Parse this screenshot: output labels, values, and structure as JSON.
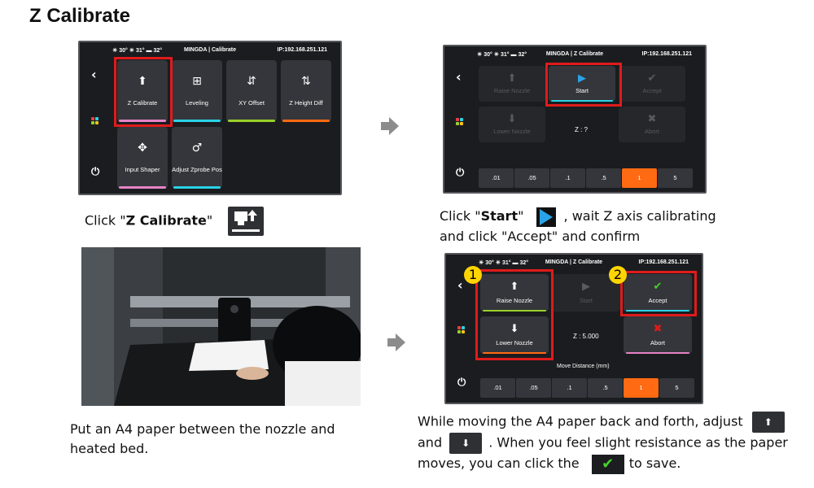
{
  "heading": "Z Calibrate",
  "status": {
    "temps": "☀ 30° ☀ 31° ▬ 32°",
    "ip": "IP:192.168.251.121"
  },
  "screen1": {
    "title": "MINGDA | Calibrate",
    "tiles": [
      {
        "label": "Z Calibrate",
        "glyph": "⬆",
        "bar": "#e683c7"
      },
      {
        "label": "Leveling",
        "glyph": "⊞",
        "bar": "#2ad2e6"
      },
      {
        "label": "XY Offset",
        "glyph": "↕",
        "bar": "#9ad12a"
      },
      {
        "label": "Z Height Diff",
        "glyph": "↕",
        "bar": "#ff6a13"
      },
      {
        "label": "Input Shaper",
        "glyph": "✥",
        "bar": "#e683c7"
      },
      {
        "label": "Adjust Zprobe Pos",
        "glyph": "♂",
        "bar": "#2ad2e6"
      }
    ]
  },
  "screen2": {
    "title": "MINGDA | Z Calibrate",
    "raise": "Raise Nozzle",
    "start": "Start",
    "accept": "Accept",
    "lower": "Lower Nozzle",
    "abort": "Abort",
    "z_value": "Z : ?",
    "distances": [
      ".01",
      ".05",
      ".1",
      ".5",
      "1",
      "5"
    ]
  },
  "screen3": {
    "title": "MINGDA | Z Calibrate",
    "raise": "Raise Nozzle",
    "start": "Start",
    "accept": "Accept",
    "lower": "Lower Nozzle",
    "abort": "Abort",
    "z_value": "Z : 5.000",
    "move_distance": "Move Distance (mm)",
    "distances": [
      ".01",
      ".05",
      ".1",
      ".5",
      "1",
      "5"
    ],
    "badges": [
      "1",
      "2"
    ]
  },
  "captions": {
    "step1_pre": "Click \"",
    "step1_bold": "Z Calibrate",
    "step1_post": "\"",
    "step2_pre": "Click \"",
    "step2_bold": "Start",
    "step2_mid": "\"",
    "step2_post": ", wait Z axis calibrating",
    "step2_line2": "and click \"Accept\" and confirm",
    "step3_line1": "Put an A4 paper between the nozzle and",
    "step3_line2": "heated bed.",
    "step4_a": "While moving the A4 paper back and forth, adjust",
    "step4_b": "and",
    "step4_c": ". When you feel slight resistance as the paper",
    "step4_d": "moves, you can click the",
    "step4_e": "to save."
  },
  "colors": {
    "highlight": "#e01b1b",
    "active_distance": "#ff6a13",
    "start_accent": "#2ad2e6",
    "accept_check": "#44d12a",
    "abort_x": "#e01b1b"
  }
}
